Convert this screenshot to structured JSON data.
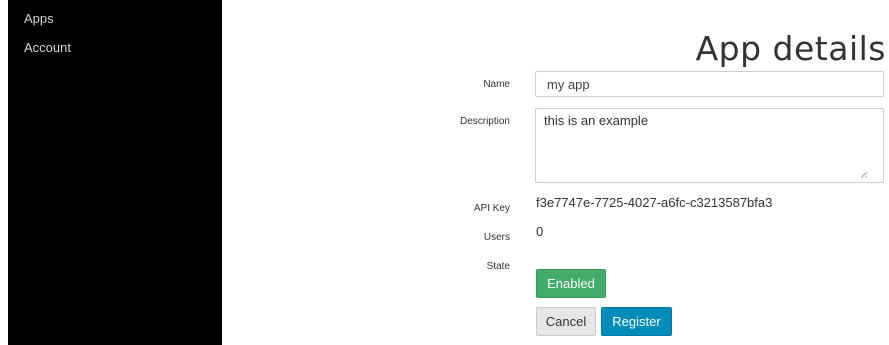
{
  "sidebar": {
    "items": [
      {
        "label": "Apps"
      },
      {
        "label": "Account"
      }
    ]
  },
  "page": {
    "title": "App details"
  },
  "form": {
    "name_label": "Name",
    "name_value": "my app",
    "description_label": "Description",
    "description_value": "this is an example",
    "api_key_label": "API Key",
    "api_key_value": "f3e7747e-7725-4027-a6fc-c3213587bfa3",
    "users_label": "Users",
    "users_value": "0",
    "state_label": "State",
    "state_value": "Enabled"
  },
  "actions": {
    "cancel_label": "Cancel",
    "register_label": "Register"
  },
  "colors": {
    "sidebar_bg": "#000000",
    "enabled": "#43ac6a",
    "register": "#008cba",
    "cancel": "#e7e7e7"
  }
}
